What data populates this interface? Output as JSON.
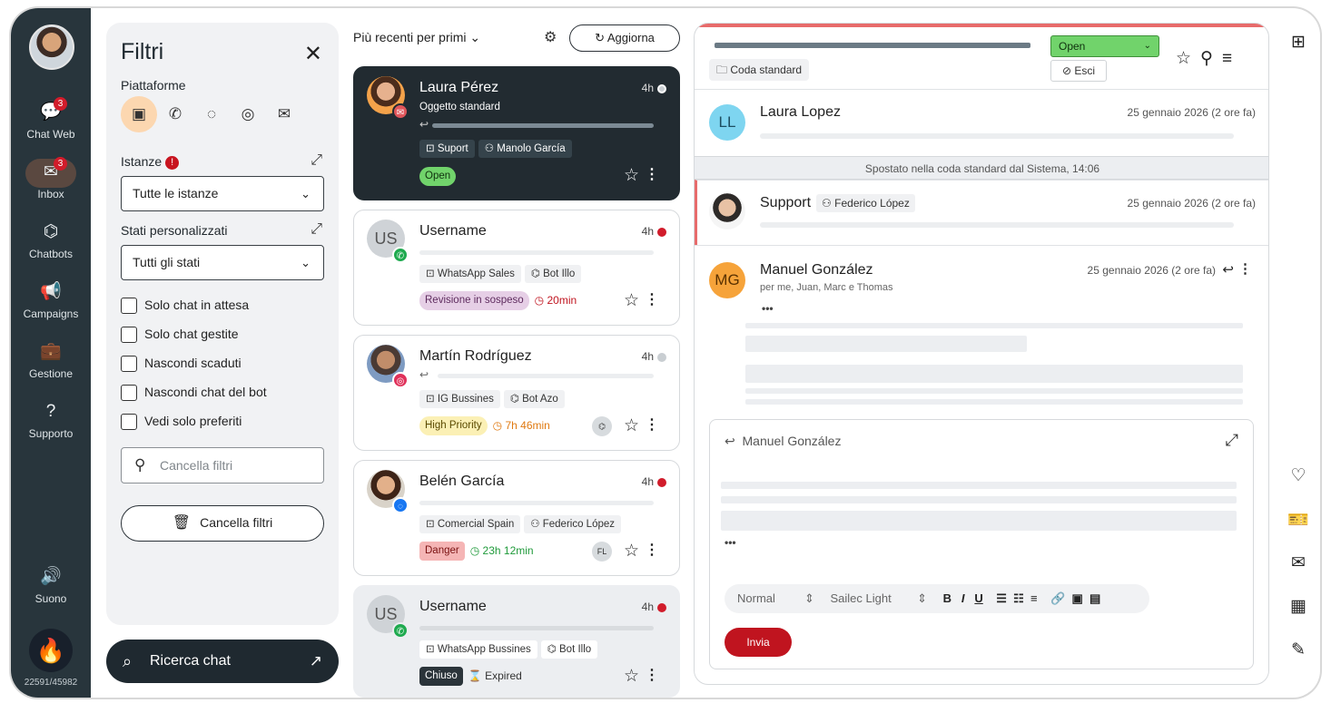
{
  "nav": {
    "items": [
      {
        "label": "Chat Web",
        "badge": "3"
      },
      {
        "label": "Inbox",
        "badge": "3"
      },
      {
        "label": "Chatbots"
      },
      {
        "label": "Campaigns"
      },
      {
        "label": "Gestione"
      },
      {
        "label": "Supporto"
      }
    ],
    "sound_label": "Suono",
    "counter": "22591/45982"
  },
  "filters": {
    "title": "Filtri",
    "platforms_label": "Piattaforme",
    "instances_label": "Istanze",
    "instances_value": "Tutte le istanze",
    "custom_states_label": "Stati personalizzati",
    "custom_states_value": "Tutti gli stati",
    "checkboxes": [
      "Solo chat in attesa",
      "Solo chat gestite",
      "Nascondi scaduti",
      "Nascondi chat del bot",
      "Vedi solo preferiti"
    ],
    "search_placeholder": "Cancella filtri",
    "clear_button": "Cancella filtri",
    "search_chat_button": "Ricerca chat"
  },
  "list": {
    "sort_label": "Più recenti per primi",
    "refresh_label": "Aggiorna",
    "cards": [
      {
        "name": "Laura Pérez",
        "time": "4h",
        "subject": "Oggetto standard",
        "tags": [
          "Suport",
          "Manolo García"
        ],
        "status": "Open"
      },
      {
        "initials": "US",
        "name": "Username",
        "time": "4h",
        "tags": [
          "WhatsApp Sales",
          "Bot Illo"
        ],
        "status": "Revisione in sospeso",
        "timer": "20min"
      },
      {
        "name": "Martín Rodríguez",
        "time": "4h",
        "tags": [
          "IG Bussines",
          "Bot Azo"
        ],
        "status": "High Priority",
        "timer": "7h 46min"
      },
      {
        "name": "Belén García",
        "time": "4h",
        "tags": [
          "Comercial Spain",
          "Federico López"
        ],
        "status": "Danger",
        "timer": "23h 12min",
        "assignee": "FL"
      },
      {
        "initials": "US",
        "name": "Username",
        "time": "4h",
        "tags": [
          "WhatsApp Bussines",
          "Bot Illo"
        ],
        "status": "Chiuso",
        "timer": "Expired"
      }
    ]
  },
  "conversation": {
    "queue": "Coda standard",
    "state": "Open",
    "exit": "Esci",
    "system_message": "Spostato nella coda standard dal Sistema, 14:06",
    "messages": [
      {
        "initials": "LL",
        "name": "Laura Lopez",
        "date": "25 gennaio 2026 (2 ore fa)"
      },
      {
        "name": "Support",
        "agent": "Federico López",
        "date": "25 gennaio 2026 (2 ore fa)"
      },
      {
        "initials": "MG",
        "name": "Manuel González",
        "recipients": "per me, Juan, Marc e Thomas",
        "date": "25 gennaio 2026 (2 ore fa)"
      }
    ],
    "reply_to": "Manuel González",
    "toolbar": {
      "style": "Normal",
      "font": "Sailec Light"
    },
    "send_label": "Invia"
  },
  "colors": {
    "accent": "#c0141f",
    "sidebar": "#28353c",
    "open_green": "#71d36b"
  }
}
